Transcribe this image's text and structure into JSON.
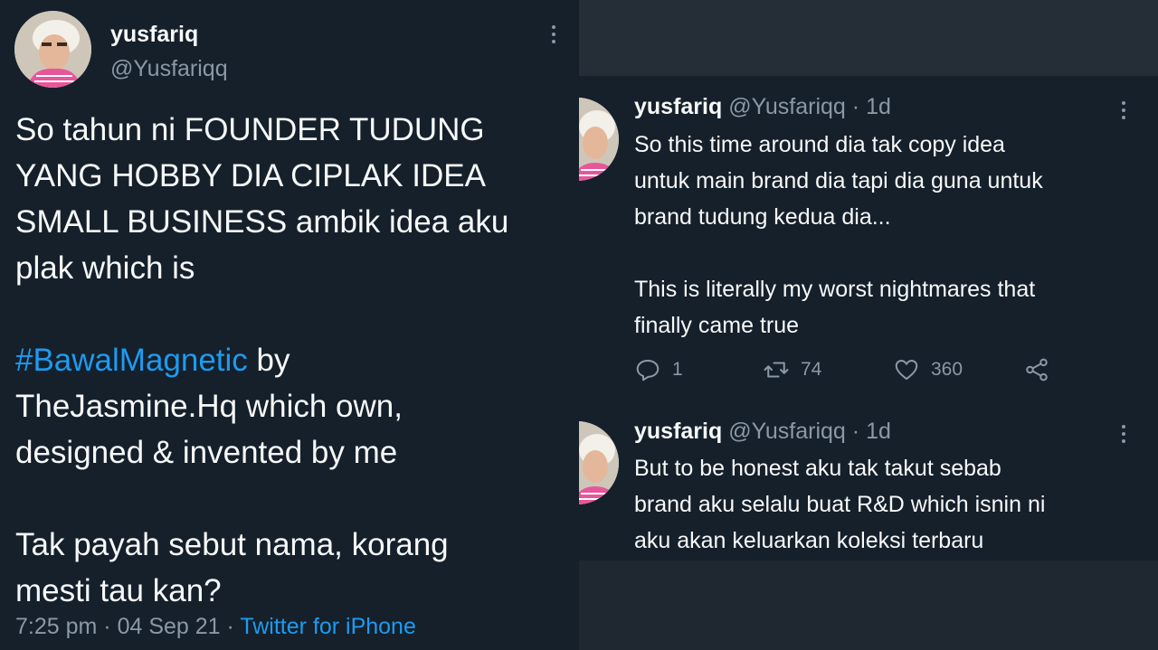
{
  "left_tweet": {
    "display_name": "yusfariq",
    "handle": "@Yusfariqq",
    "body_line_1": "So tahun ni FOUNDER TUDUNG",
    "body_line_2": "YANG HOBBY DIA CIPLAK IDEA",
    "body_line_3": "SMALL BUSINESS ambik idea aku",
    "body_line_4": "plak which is",
    "hashtag": "#BawalMagnetic",
    "after_hashtag": " by",
    "body_line_6": "TheJasmine.Hq which own,",
    "body_line_7": "designed & invented by me",
    "body_line_8": "Tak payah sebut nama, korang",
    "body_line_9": "mesti tau kan?",
    "time": "7:25 pm",
    "sep": " · ",
    "date": "04 Sep 21",
    "source": "Twitter for iPhone"
  },
  "right_tweets": [
    {
      "display_name": "yusfariq",
      "handle": "@Yusfariqq",
      "age": "1d",
      "line_1": "So this time around dia tak copy idea",
      "line_2": "untuk main brand dia tapi dia guna untuk",
      "line_3": "brand tudung kedua dia...",
      "line_4": "This is literally my worst nightmares that",
      "line_5": "finally came true",
      "replies": "1",
      "retweets": "74",
      "likes": "360"
    },
    {
      "display_name": "yusfariq",
      "handle": "@Yusfariqq",
      "age": "1d",
      "line_1": "But to be honest aku tak takut sebab",
      "line_2": "brand aku selalu buat R&D which isnin ni",
      "line_3": "aku akan keluarkan koleksi terbaru"
    }
  ],
  "colors": {
    "background": "#15202b",
    "text": "#f7f9f9",
    "muted": "#8b98a5",
    "accent": "#1d9bf0"
  },
  "icons": [
    "more-options-icon",
    "reply-icon",
    "retweet-icon",
    "like-icon",
    "share-icon"
  ]
}
